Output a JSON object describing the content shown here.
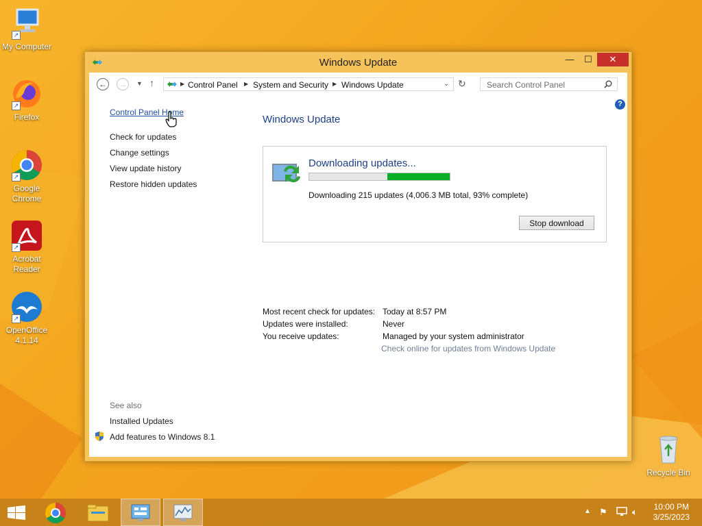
{
  "desktop": {
    "icons": [
      {
        "label": "My Computer"
      },
      {
        "label": "Firefox"
      },
      {
        "label": "Google Chrome"
      },
      {
        "label": "Acrobat Reader"
      },
      {
        "label": "OpenOffice 4.1.14"
      },
      {
        "label": "Recycle Bin"
      }
    ]
  },
  "window": {
    "title": "Windows Update",
    "controls": {
      "minimize": "—",
      "maximize": "☐",
      "close": "✕"
    }
  },
  "address": {
    "breadcrumbs": [
      "Control Panel",
      "System and Security",
      "Windows Update"
    ],
    "search_placeholder": "Search Control Panel"
  },
  "sidebar": {
    "links": [
      {
        "label": "Control Panel Home"
      },
      {
        "label": "Check for updates"
      },
      {
        "label": "Change settings"
      },
      {
        "label": "View update history"
      },
      {
        "label": "Restore hidden updates"
      }
    ],
    "see_also_heading": "See also",
    "see_also": [
      {
        "label": "Installed Updates"
      },
      {
        "label": "Add features to Windows 8.1"
      }
    ]
  },
  "main": {
    "title": "Windows Update",
    "status": {
      "heading": "Downloading updates...",
      "progress_percent": 93,
      "detail": "Downloading 215 updates (4,006.3 MB total, 93% complete)",
      "stop_button": "Stop download"
    },
    "info": [
      {
        "label": "Most recent check for updates:",
        "value": "Today at 8:57 PM"
      },
      {
        "label": "Updates were installed:",
        "value": "Never"
      },
      {
        "label": "You receive updates:",
        "value": "Managed by your system administrator"
      }
    ],
    "online_link": "Check online for updates from Windows Update"
  },
  "taskbar": {
    "clock_time": "10:00 PM",
    "clock_date": "3/25/2023"
  },
  "colors": {
    "desktop": "#f3a41d",
    "progress_fill": "#06b025",
    "heading_blue": "#1e3f88",
    "close_red": "#c7302b"
  }
}
